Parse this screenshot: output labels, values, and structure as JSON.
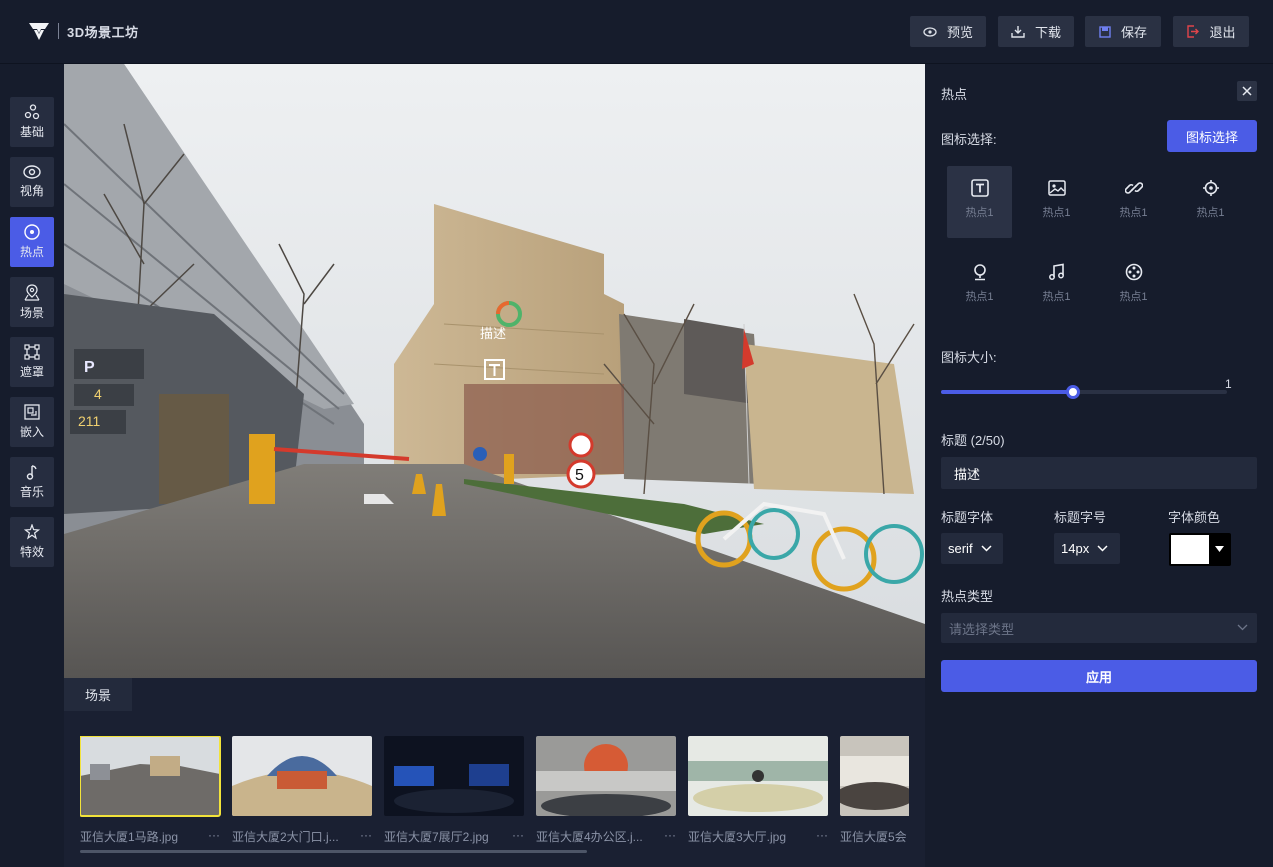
{
  "app": {
    "title": "3D场景工坊"
  },
  "toolbar": {
    "preview_label": "预览",
    "download_label": "下载",
    "save_label": "保存",
    "exit_label": "退出"
  },
  "sidebar": {
    "items": [
      {
        "label": "基础",
        "icon": "nodes-icon"
      },
      {
        "label": "视角",
        "icon": "eye-icon"
      },
      {
        "label": "热点",
        "icon": "target-icon",
        "active": true
      },
      {
        "label": "场景",
        "icon": "map-pin-icon"
      },
      {
        "label": "遮罩",
        "icon": "mask-icon"
      },
      {
        "label": "嵌入",
        "icon": "embed-icon"
      },
      {
        "label": "音乐",
        "icon": "music-icon"
      },
      {
        "label": "特效",
        "icon": "sparkle-icon"
      }
    ]
  },
  "viewer": {
    "hotspot_label": "描述"
  },
  "scenes": {
    "tab_label": "场景",
    "items": [
      {
        "name": "亚信大厦1马路.jpg",
        "selected": true
      },
      {
        "name": "亚信大厦2大门口.j..."
      },
      {
        "name": "亚信大厦7展厅2.jpg"
      },
      {
        "name": "亚信大厦4办公区.j..."
      },
      {
        "name": "亚信大厦3大厅.jpg"
      },
      {
        "name": "亚信大厦5会"
      }
    ],
    "more_label": "···"
  },
  "panel": {
    "title": "热点",
    "icon_select_label": "图标选择:",
    "icon_select_button": "图标选择",
    "icons": [
      {
        "label": "热点1",
        "icon": "text-icon",
        "selected": true
      },
      {
        "label": "热点1",
        "icon": "image-icon"
      },
      {
        "label": "热点1",
        "icon": "link-icon"
      },
      {
        "label": "热点1",
        "icon": "crosshair-icon"
      },
      {
        "label": "热点1",
        "icon": "location-icon"
      },
      {
        "label": "热点1",
        "icon": "music-note-icon"
      },
      {
        "label": "热点1",
        "icon": "film-reel-icon"
      }
    ],
    "icon_size_label": "图标大小:",
    "icon_size_value": "1",
    "icon_size_fraction": 0.46,
    "title_label": "标题 (2/50)",
    "title_value": "描述",
    "title_font_label": "标题字体",
    "title_font_value": "serif",
    "title_size_label": "标题字号",
    "title_size_value": "14px",
    "font_color_label": "字体颜色",
    "font_color_value": "#ffffff",
    "hotspot_type_label": "热点类型",
    "hotspot_type_placeholder": "请选择类型",
    "apply_label": "应用"
  },
  "colors": {
    "accent": "#4b5ce6",
    "background": "#141a2a",
    "selected_thumb": "#f2e33a"
  }
}
